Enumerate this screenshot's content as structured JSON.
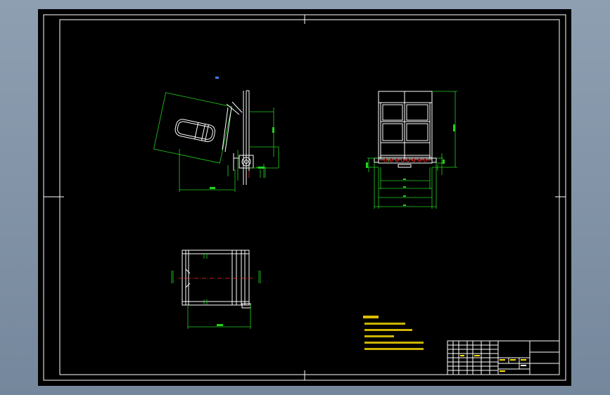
{
  "drawing": {
    "colors": {
      "paper": "#000000",
      "frame": "#ffffff",
      "dimension": "#22d11e",
      "hidden_center": "#ff2a2a",
      "notes": "#ffe000",
      "marker": "#3a7dff",
      "workspace": "#7e8fa3"
    }
  }
}
